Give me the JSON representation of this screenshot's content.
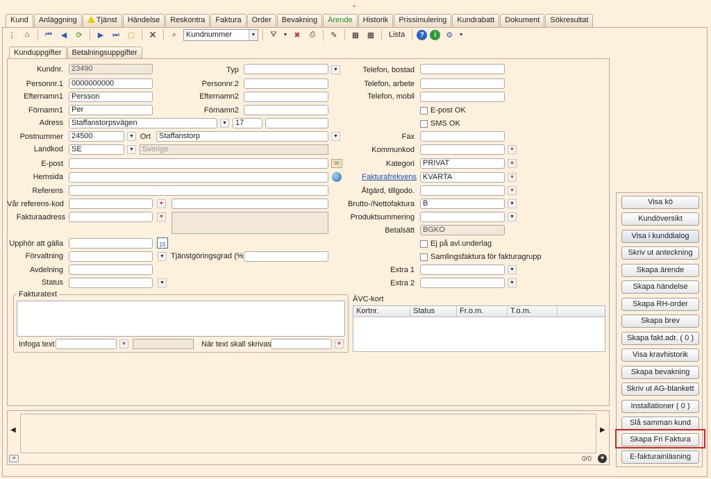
{
  "tabs": [
    "Kund",
    "Anläggning",
    "Tjänst",
    "Händelse",
    "Reskontra",
    "Faktura",
    "Order",
    "Bevakning",
    "Ärende",
    "Historik",
    "Prissimulering",
    "Kundrabatt",
    "Dokument",
    "Sökresultat"
  ],
  "toolbar": {
    "search_field": "Kundnummer",
    "list_label": "Lista"
  },
  "subtabs": [
    "Kunduppgifter",
    "Betalningsuppgifter"
  ],
  "labels": {
    "kundnr": "Kundnr.",
    "personnr1": "Personnr.1",
    "efternamn1": "Efternamn1",
    "fornamn1": "Förnamn1",
    "adress": "Adress",
    "postnummer": "Postnummer",
    "ort": "Ort",
    "landkod": "Landkod",
    "epost": "E-post",
    "hemsida": "Hemsida",
    "referens": "Referens",
    "var_referens": "Vår referens-kod",
    "fakturaadress": "Fakturaadress",
    "typ": "Typ",
    "personnr2": "Personnr.2",
    "efternamn2": "Efternamn2",
    "fornamn2": "Förnamn2",
    "tel_bostad": "Telefon, bostad",
    "tel_arbete": "Telefon, arbete",
    "tel_mobil": "Telefon, mobil",
    "epost_ok": "E-post OK",
    "sms_ok": "SMS OK",
    "fax": "Fax",
    "kommunkod": "Kommunkod",
    "kategori": "Kategori",
    "fakturafrekvens": "Fakturafrekvens",
    "atgard": "Åtgärd, tillgodo.",
    "brutto": "Brutto-/Nettofaktura",
    "produktsummering": "Produktsummering",
    "betalsatt": "Betalsätt",
    "upphor": "Upphör att gälla",
    "forvaltning": "Förvaltning",
    "tjanstgoring": "Tjänstgöringsgrad  (%)",
    "avdelning": "Avdelning",
    "status": "Status",
    "ej_avl": "Ej på avl.underlag",
    "samlingsfaktura": "Samlingsfaktura för fakturagrupp",
    "extra1": "Extra 1",
    "extra2": "Extra 2",
    "fakturatext": "Fakturatext",
    "infoga_text": "Infoga text",
    "nar_text": "När text skall skrivas",
    "avc_kort": "ÄVC-kort"
  },
  "values": {
    "kundnr": "23490",
    "personnr1": "0000000000",
    "efternamn1": "Persson",
    "fornamn1": "Per",
    "adress": "Staffanstorpsvägen",
    "adress_nr": "17",
    "postnummer": "24500",
    "ort": "Staffanstorp",
    "landkod": "SE",
    "land": "Sverige",
    "kategori": "PRIVAT",
    "fakturafrekvens": "KVARTA",
    "brutto": "B",
    "betalsatt": "BGKO"
  },
  "avc_columns": [
    "Kortnr.",
    "Status",
    "Fr.o.m.",
    "T.o.m."
  ],
  "side_buttons": [
    "Visa kö",
    "Kundöversikt",
    "Visa i kunddialog",
    "Skriv ut anteckning",
    "Skapa ärende",
    "Skapa händelse",
    "Skapa RH-order",
    "Skapa brev",
    "Skapa fakt.adr. ( 0 )",
    "Visa kravhistorik",
    "Skapa bevakning",
    "Skriv ut AG-blankett",
    "Installationer ( 0 )",
    "Slå samman kund",
    "Skapa Fri Faktura",
    "E-fakturainläsning"
  ],
  "memo_counter": "0/0"
}
